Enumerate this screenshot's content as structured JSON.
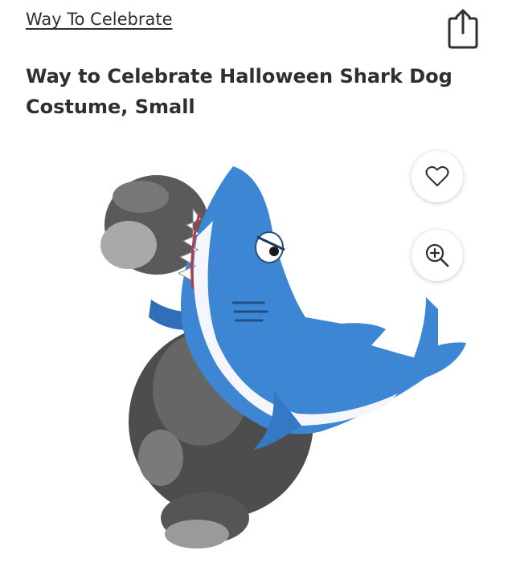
{
  "product": {
    "brand_link": "Way To Celebrate",
    "title": "Way to Celebrate Halloween Shark Dog Costume, Small"
  },
  "icons": {
    "share": "share-icon",
    "favorite": "heart-outline-icon",
    "zoom": "zoom-in-icon"
  },
  "colors": {
    "text": "#2e2f32",
    "shark_blue": "#3d86d3",
    "shark_belly": "#f4f6fb",
    "dog_fur": "#4a4a4a"
  }
}
